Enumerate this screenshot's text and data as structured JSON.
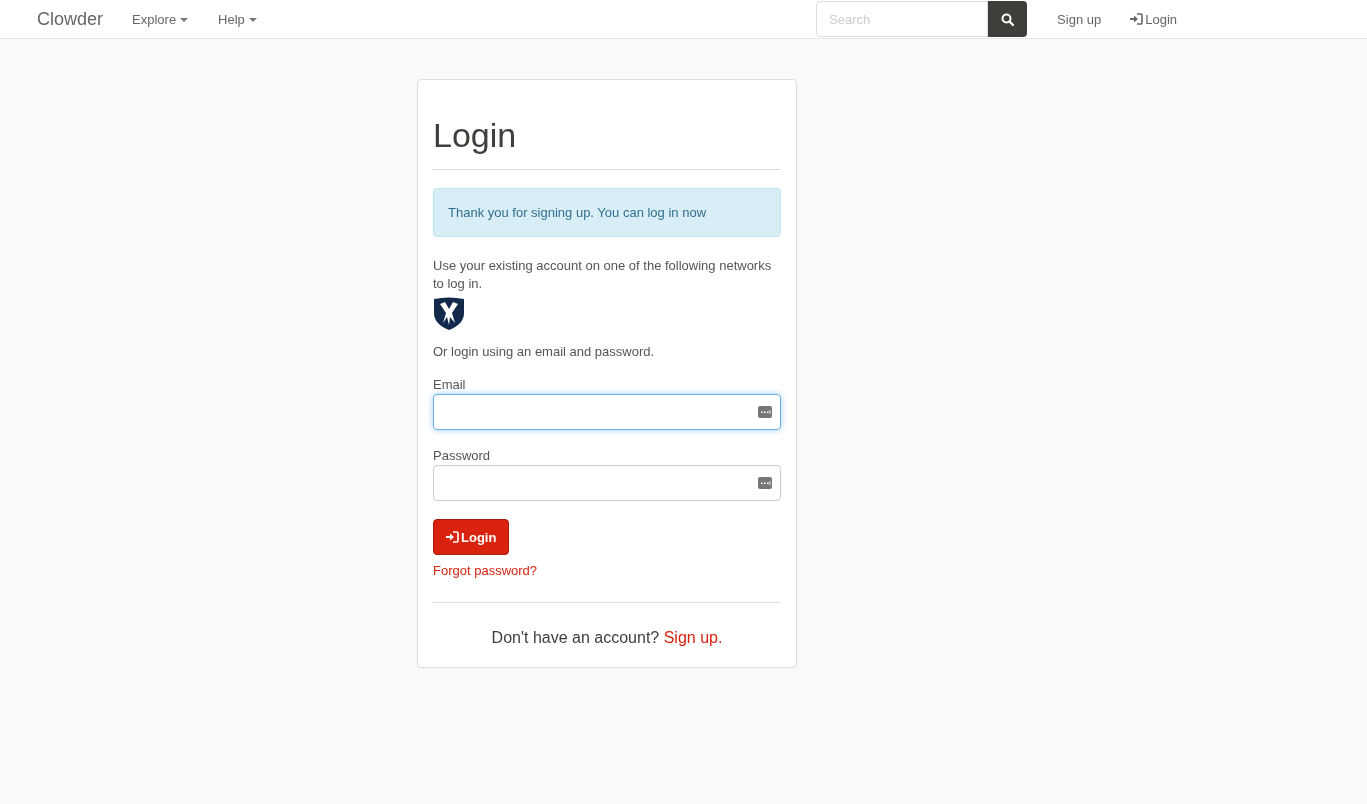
{
  "navbar": {
    "brand": "Clowder",
    "menus": [
      {
        "label": "Explore"
      },
      {
        "label": "Help"
      }
    ],
    "search": {
      "placeholder": "Search"
    },
    "links": [
      {
        "label": "Sign up",
        "icon": false
      },
      {
        "label": "Login",
        "icon": true
      }
    ]
  },
  "card": {
    "title": "Login",
    "alert": "Thank you for signing up. You can log in now",
    "networks_text": "Use your existing account on one of the following networks to log in.",
    "or_text": "Or login using an email and password.",
    "fields": [
      {
        "label": "Email",
        "focused": true
      },
      {
        "label": "Password",
        "focused": false
      }
    ],
    "button": "Login",
    "forgot": "Forgot password?",
    "footer_text": "Don't have an account?",
    "footer_link": "Sign up."
  }
}
